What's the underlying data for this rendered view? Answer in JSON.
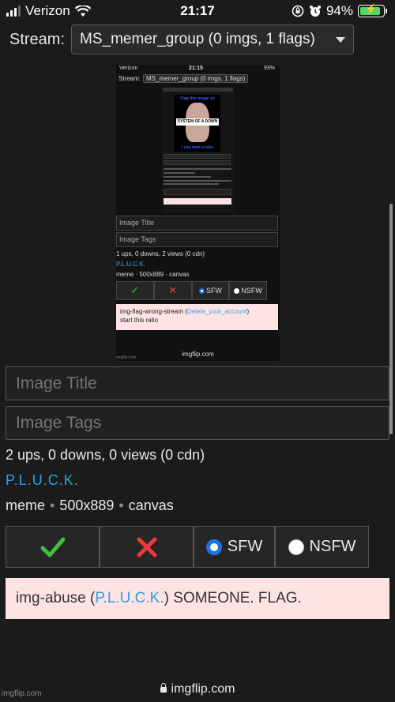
{
  "status_bar": {
    "carrier": "Verizon",
    "time": "21:17",
    "battery": "94%",
    "battery_level": 0.94
  },
  "stream": {
    "label": "Stream:",
    "selected": "MS_memer_group (0 imgs, 1 flags)"
  },
  "preview": {
    "status_carrier": "Verizon",
    "status_time": "21:15",
    "status_battery": "93%",
    "stream_label": "Stream:",
    "stream_selected": "MS_memer_group (0 imgs, 1 flags)",
    "meme_top_text": "Flag this image so",
    "meme_band_text": "SYSTEM OF A DOWN",
    "meme_bottom_text": "I can start a ratio",
    "title_placeholder": "Image Title",
    "tags_placeholder": "Image Tags",
    "stats": "1 ups, 0 downs, 2 views (0 cdn)",
    "user": "P.L.U.C.K.",
    "meta": "meme · 500x889 · canvas",
    "sfw_label": "SFW",
    "nsfw_label": "NSFW",
    "flag_prefix": "img-flag-wrong-stream (",
    "flag_link": "Delete_your_account",
    "flag_suffix": ")",
    "flag_line2": "start this ratio",
    "footer_url": "imgflip.com",
    "watermark": "imgflip.com"
  },
  "form": {
    "title_placeholder": "Image Title",
    "tags_placeholder": "Image Tags",
    "stats": "2 ups, 0 downs, 0 views (0 cdn)",
    "user": "P.L.U.C.K.",
    "meta_type": "meme",
    "meta_size": "500x889",
    "meta_render": "canvas",
    "approve_icon": "check-icon",
    "reject_icon": "x-icon",
    "sfw_label": "SFW",
    "nsfw_label": "NSFW",
    "sfw_selected": true
  },
  "flag": {
    "prefix": "img-abuse (",
    "link": "P.L.U.C.K.",
    "suffix": ") SOMEONE. FLAG."
  },
  "footer": {
    "url": "imgflip.com",
    "watermark": "imgflip.com"
  },
  "colors": {
    "background": "#1b1b1b",
    "link": "#2f9fe0",
    "check": "#3fbf3f",
    "cross": "#e83a3a",
    "radio_selected": "#1a73e8",
    "flag_bg": "#fde3e3"
  }
}
